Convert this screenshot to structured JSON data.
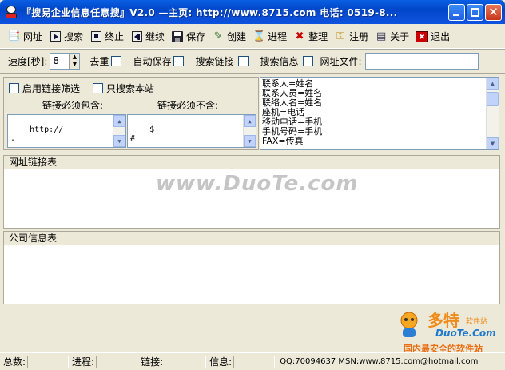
{
  "window": {
    "title": "『搜易企业信息任意搜』V2.0 —主页: http://www.8715.com 电话: 0519-8..."
  },
  "toolbar": {
    "items": [
      {
        "label": "网址",
        "icon": "url-list-icon"
      },
      {
        "label": "搜索",
        "icon": "play-icon"
      },
      {
        "label": "终止",
        "icon": "stop-icon"
      },
      {
        "label": "继续",
        "icon": "resume-icon"
      },
      {
        "label": "保存",
        "icon": "save-disk-icon"
      },
      {
        "label": "创建",
        "icon": "create-icon"
      },
      {
        "label": "进程",
        "icon": "process-icon"
      },
      {
        "label": "整理",
        "icon": "cleanup-x-icon"
      },
      {
        "label": "注册",
        "icon": "key-icon"
      },
      {
        "label": "关于",
        "icon": "about-icon"
      },
      {
        "label": "退出",
        "icon": "exit-icon"
      }
    ]
  },
  "settings": {
    "speed_label": "速度[秒]:",
    "speed_value": "8",
    "dedupe_label": "去重",
    "autosave_label": "自动保存",
    "search_links_label": "搜索链接",
    "search_info_label": "搜索信息",
    "url_file_label": "网址文件:",
    "url_file_value": ""
  },
  "filter": {
    "enable_label": "启用链接筛选",
    "site_only_label": "只搜索本站",
    "must_include_label": "链接必须包含:",
    "must_exclude_label": "链接必须不含:",
    "include_text": "http://\n.",
    "exclude_text": "$\n#"
  },
  "fields_text": "联系人=姓名\n联系人员=姓名\n联络人名=姓名\n座机=电话\n移动电话=手机\n手机号码=手机\nFAX=传真",
  "panels": {
    "links_title": "网址链接表",
    "company_title": "公司信息表"
  },
  "watermark": {
    "center": "www.DuoTe.com",
    "logo_big": "多特",
    "logo_small": "软件站",
    "logo_domain": "DuoTe.Com",
    "logo_sub": "国内最安全的软件站"
  },
  "status": {
    "total_label": "总数:",
    "process_label": "进程:",
    "link_label": "链接:",
    "info_label": "信息:",
    "contact": "QQ:70094637 MSN:www.8715.com@hotmail.com"
  }
}
